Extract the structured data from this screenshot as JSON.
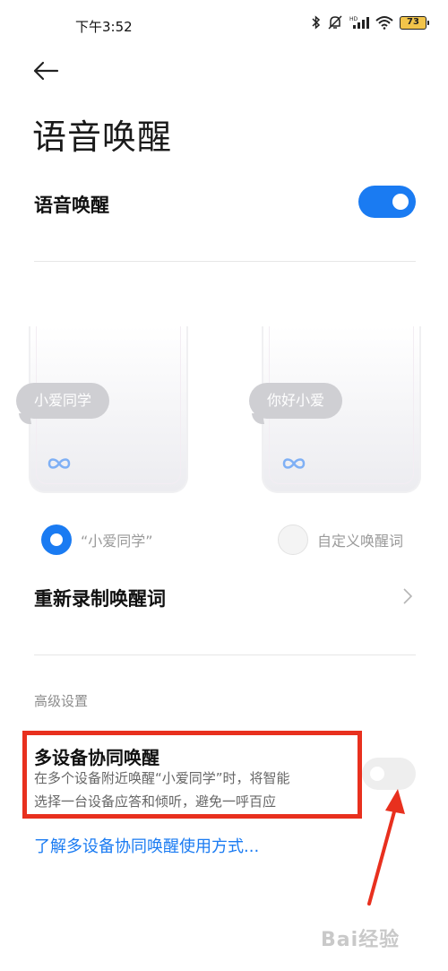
{
  "status_bar": {
    "time": "下午3:52",
    "battery": "73",
    "icons": [
      "bluetooth-icon",
      "mute-icon",
      "hd-signal-icon",
      "wifi-icon",
      "battery-icon"
    ]
  },
  "page": {
    "title": "语音唤醒"
  },
  "voice_wake": {
    "label": "语音唤醒",
    "enabled": true
  },
  "previews": {
    "left_bubble": "小爱同学",
    "right_bubble": "你好小爱"
  },
  "wake_words": {
    "option_default": "“小爱同学”",
    "option_custom": "自定义唤醒词",
    "selected": "option_default"
  },
  "rerecord": {
    "label": "重新录制唤醒词"
  },
  "advanced": {
    "section_label": "高级设置",
    "multi_device": {
      "title": "多设备协同唤醒",
      "desc_line1": "在多个设备附近唤醒“小爱同学”时，将智能",
      "desc_line2": "选择一台设备应答和倾听，避免一呼百应",
      "enabled": false
    },
    "learn_more": "了解多设备协同唤醒使用方式..."
  },
  "watermark": "Bai经验",
  "colors": {
    "accent": "#1a7bf2",
    "annotation": "#e8301e"
  }
}
